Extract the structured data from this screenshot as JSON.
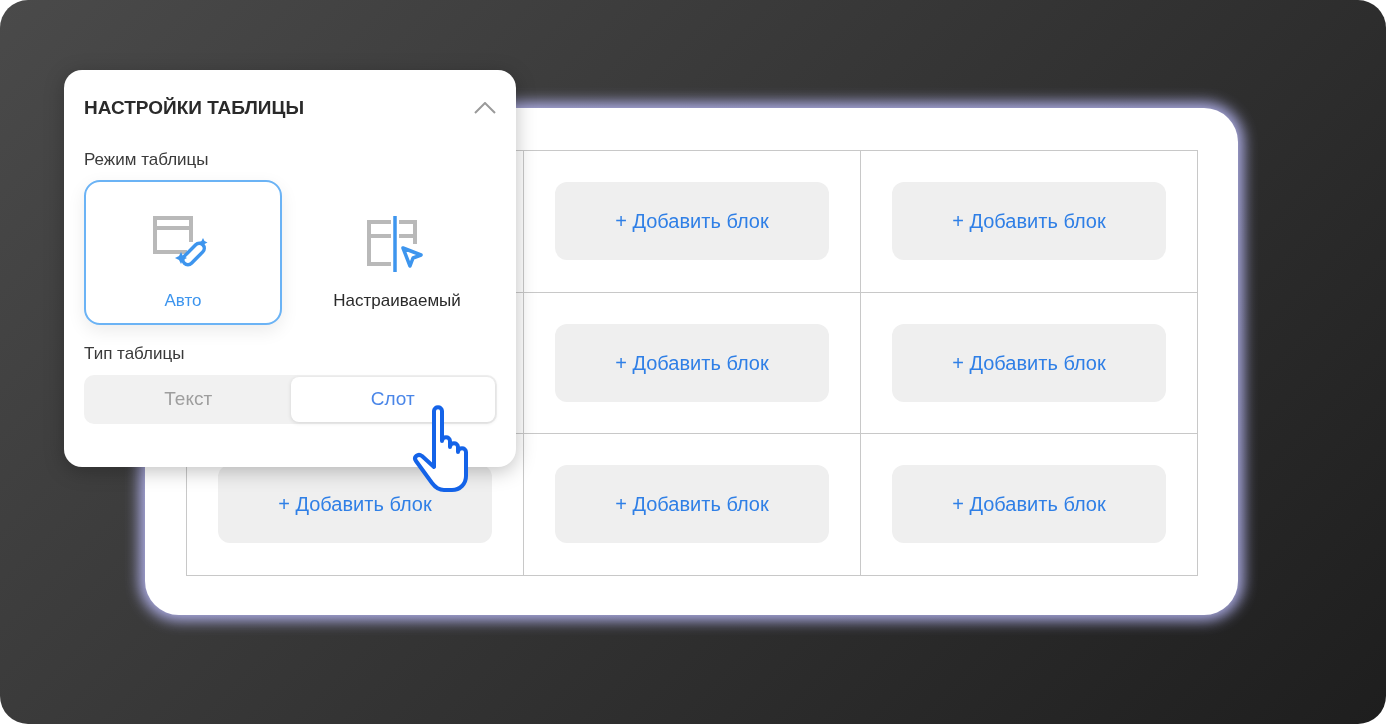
{
  "panel": {
    "title": "НАСТРОЙКИ ТАБЛИЦЫ",
    "expanded": true,
    "mode_label": "Режим таблицы",
    "modes": [
      {
        "kind": "auto",
        "label": "Авто",
        "selected": true
      },
      {
        "kind": "custom",
        "label": "Настраиваемый",
        "selected": false
      }
    ],
    "type_label": "Тип таблицы",
    "types": [
      {
        "label": "Текст",
        "selected": false
      },
      {
        "label": "Слот",
        "selected": true
      }
    ]
  },
  "table": {
    "rows": [
      [
        null,
        "+ Добавить блок",
        "+ Добавить блок"
      ],
      [
        null,
        "+ Добавить блок",
        "+ Добавить блок"
      ],
      [
        "+ Добавить блок",
        "+ Добавить блок",
        "+ Добавить блок"
      ]
    ]
  }
}
